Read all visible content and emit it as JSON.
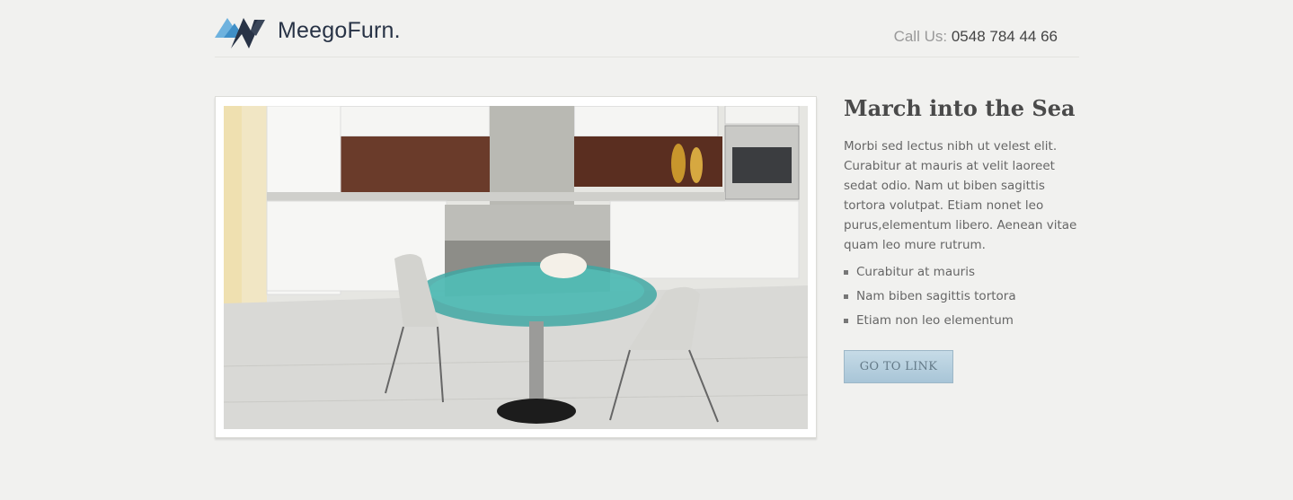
{
  "brand": {
    "name": "MeegoFurn.",
    "logo_icon": "mountain-logo-icon"
  },
  "header": {
    "call_label": "Call Us:",
    "phone": "0548 784 44 66"
  },
  "feature": {
    "image_icon": "kitchen-photo",
    "title": "March into the Sea",
    "description": "Morbi sed lectus nibh ut velest elit. Curabitur at mauris at velit laoreet sedat odio. Nam ut biben sagittis tortora volutpat. Etiam nonet leo purus,elementum libero. Aenean vitae quam leo mure rutrum.",
    "bullets": [
      "Curabitur at mauris",
      "Nam biben sagittis tortora",
      "Etiam non leo elementum"
    ],
    "button_label": "GO TO LINK"
  },
  "colors": {
    "brand_dark": "#283346",
    "brand_light": "#5fa6d6",
    "button": "#b3cfde"
  }
}
